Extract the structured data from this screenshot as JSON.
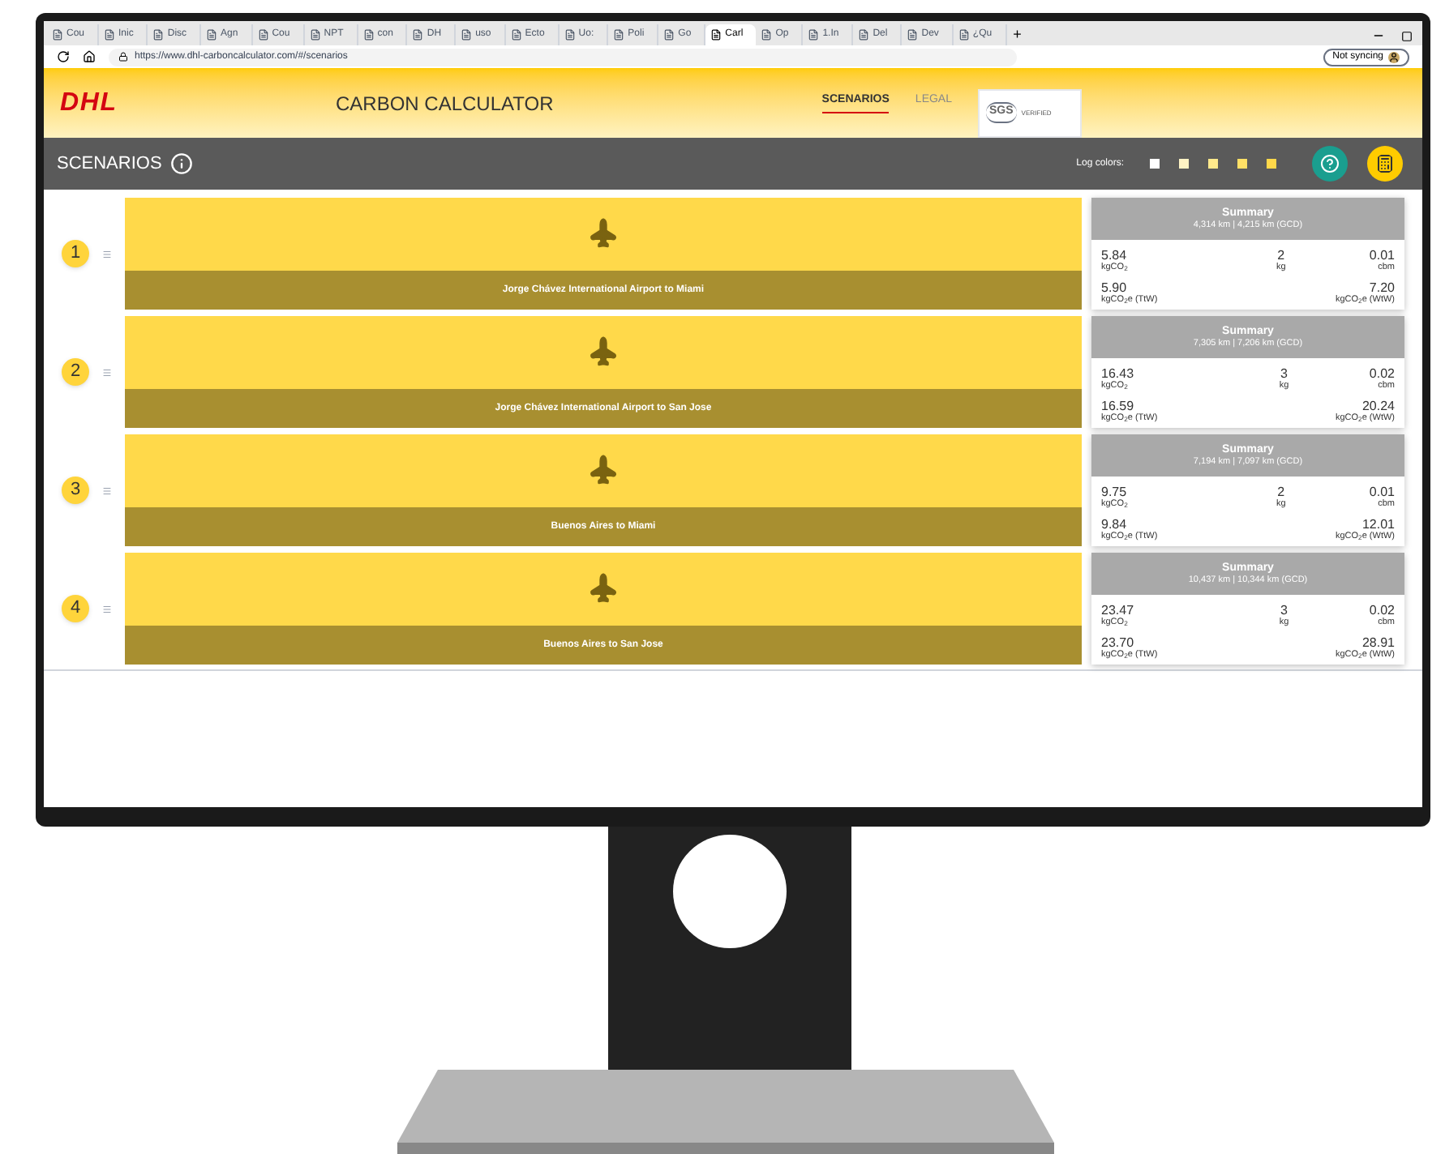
{
  "browser": {
    "tabs": [
      {
        "title": "Cou",
        "selected": false
      },
      {
        "title": "Inic",
        "selected": false
      },
      {
        "title": "Disc",
        "selected": false
      },
      {
        "title": "Agn",
        "selected": false
      },
      {
        "title": "Cou",
        "selected": false
      },
      {
        "title": "NPT",
        "selected": false
      },
      {
        "title": "con",
        "selected": false
      },
      {
        "title": "DH",
        "selected": false
      },
      {
        "title": "uso",
        "selected": false
      },
      {
        "title": "Ecto",
        "selected": false
      },
      {
        "title": "Uo:",
        "selected": false
      },
      {
        "title": "Poli",
        "selected": false
      },
      {
        "title": "Go",
        "selected": false
      },
      {
        "title": "Carl",
        "selected": true
      },
      {
        "title": "Op",
        "selected": false
      },
      {
        "title": "1.In",
        "selected": false
      },
      {
        "title": "Del",
        "selected": false
      },
      {
        "title": "Dev",
        "selected": false
      },
      {
        "title": "¿Qu",
        "selected": false
      }
    ],
    "new_tab": "+",
    "address": "https://www.dhl-carboncalculator.com/#/scenarios",
    "sync_button": "Not syncing"
  },
  "header": {
    "logo": "DHL",
    "title": "CARBON CALCULATOR",
    "nav": [
      {
        "label": "SCENARIOS",
        "selected": true
      },
      {
        "label": "LEGAL",
        "selected": false
      }
    ],
    "badge": {
      "brand": "SGS",
      "text": "VERIFIED"
    }
  },
  "toolbar": {
    "title": "SCENARIOS",
    "legend_label": "Log colors:",
    "log_colors": [
      {
        "color": "#ffffff"
      },
      {
        "color": "#fff3c4"
      },
      {
        "color": "#ffe98c"
      },
      {
        "color": "#ffe066"
      },
      {
        "color": "#ffd84a"
      }
    ]
  },
  "scenarios": [
    {
      "number": "1",
      "route": "Jorge Chávez International Airport to Miami",
      "summary_title": "Summary",
      "distance": "4,314 km | 4,215 km (GCD)",
      "co2": "5.84",
      "co2_unit": "kgCO$_{2}$",
      "weight": "2",
      "weight_unit": "kg",
      "volume": "0.01",
      "volume_unit": "cbm",
      "ttw": "5.90",
      "ttw_unit": "kgCO$_{2}$e (TtW)",
      "wtw": "7.20",
      "wtw_unit": "kgCO$_{2}$e (WtW)"
    },
    {
      "number": "2",
      "route": "Jorge Chávez International Airport to San Jose",
      "summary_title": "Summary",
      "distance": "7,305 km | 7,206 km (GCD)",
      "co2": "16.43",
      "co2_unit": "kgCO$_{2}$",
      "weight": "3",
      "weight_unit": "kg",
      "volume": "0.02",
      "volume_unit": "cbm",
      "ttw": "16.59",
      "ttw_unit": "kgCO$_{2}$e (TtW)",
      "wtw": "20.24",
      "wtw_unit": "kgCO$_{2}$e (WtW)"
    },
    {
      "number": "3",
      "route": "Buenos Aires to Miami",
      "summary_title": "Summary",
      "distance": "7,194 km | 7,097 km (GCD)",
      "co2": "9.75",
      "co2_unit": "kgCO$_{2}$",
      "weight": "2",
      "weight_unit": "kg",
      "volume": "0.01",
      "volume_unit": "cbm",
      "ttw": "9.84",
      "ttw_unit": "kgCO$_{2}$e (TtW)",
      "wtw": "12.01",
      "wtw_unit": "kgCO$_{2}$e (WtW)"
    },
    {
      "number": "4",
      "route": "Buenos Aires to San Jose",
      "summary_title": "Summary",
      "distance": "10,437 km | 10,344 km (GCD)",
      "co2": "23.47",
      "co2_unit": "kgCO$_{2}$",
      "weight": "3",
      "weight_unit": "kg",
      "volume": "0.02",
      "volume_unit": "cbm",
      "ttw": "23.70",
      "ttw_unit": "kgCO$_{2}$e (TtW)",
      "wtw": "28.91",
      "wtw_unit": "kgCO$_{2}$e (WtW)"
    }
  ]
}
